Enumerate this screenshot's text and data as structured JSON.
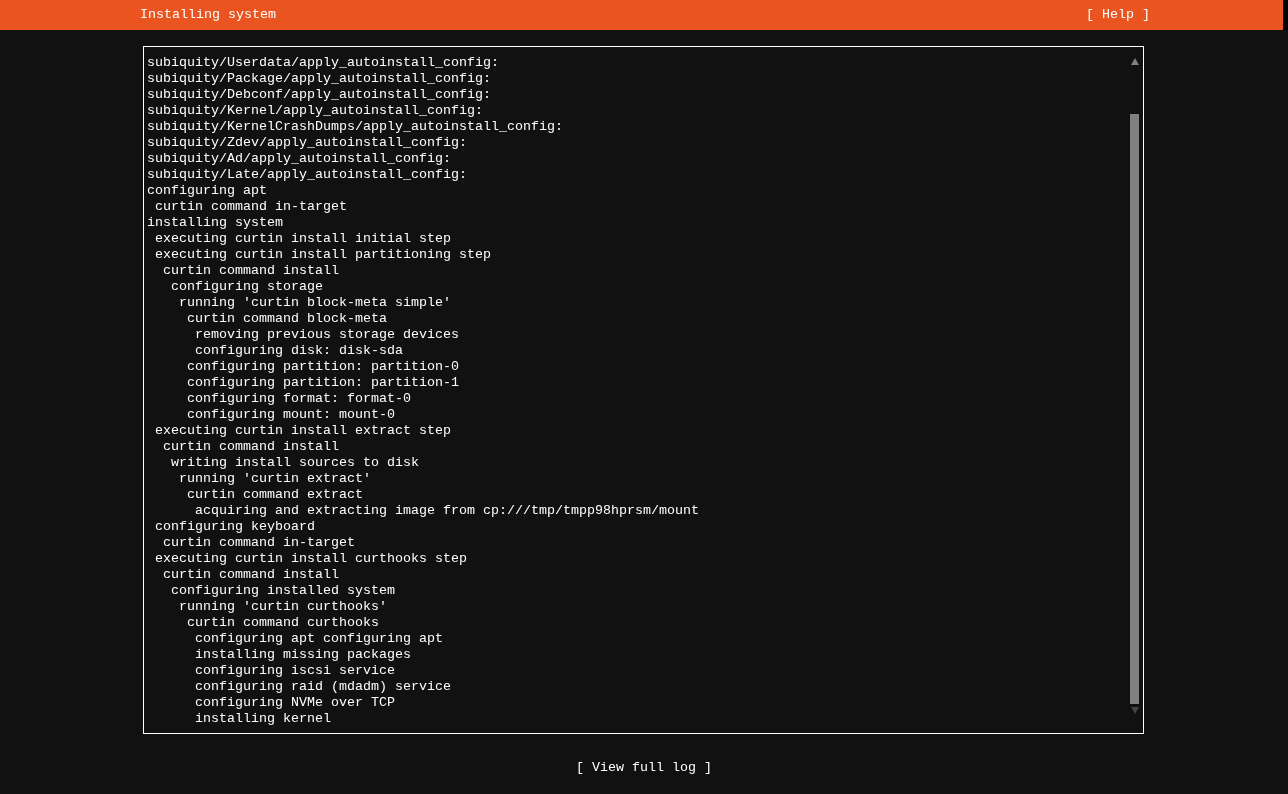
{
  "header": {
    "title": "Installing system",
    "help_button": "[ Help ]"
  },
  "log": [
    {
      "text": "subiquity/Userdata/apply_autoinstall_config:"
    },
    {
      "text": "subiquity/Package/apply_autoinstall_config:"
    },
    {
      "text": "subiquity/Debconf/apply_autoinstall_config:"
    },
    {
      "text": "subiquity/Kernel/apply_autoinstall_config:"
    },
    {
      "text": "subiquity/KernelCrashDumps/apply_autoinstall_config:"
    },
    {
      "text": "subiquity/Zdev/apply_autoinstall_config:"
    },
    {
      "text": "subiquity/Ad/apply_autoinstall_config:"
    },
    {
      "text": "subiquity/Late/apply_autoinstall_config:"
    },
    {
      "text": "configuring apt",
      "children": [
        {
          "text": "curtin command in-target"
        }
      ]
    },
    {
      "text": "installing system",
      "children": [
        {
          "text": "executing curtin install initial step"
        },
        {
          "text": "executing curtin install partitioning step",
          "children": [
            {
              "text": "curtin command install",
              "children": [
                {
                  "text": "configuring storage",
                  "children": [
                    {
                      "text": "running 'curtin block-meta simple'",
                      "children": [
                        {
                          "text": "curtin command block-meta",
                          "children": [
                            {
                              "text": "removing previous storage devices"
                            },
                            {
                              "text": "configuring disk: disk-sda"
                            }
                          ]
                        },
                        {
                          "text": "configuring partition: partition-0"
                        },
                        {
                          "text": "configuring partition: partition-1"
                        },
                        {
                          "text": "configuring format: format-0"
                        },
                        {
                          "text": "configuring mount: mount-0"
                        }
                      ]
                    }
                  ]
                }
              ]
            }
          ]
        },
        {
          "text": "executing curtin install extract step",
          "children": [
            {
              "text": "curtin command install",
              "children": [
                {
                  "text": "writing install sources to disk",
                  "children": [
                    {
                      "text": "running 'curtin extract'",
                      "children": [
                        {
                          "text": "curtin command extract",
                          "children": [
                            {
                              "text": "acquiring and extracting image from cp:///tmp/tmpp98hprsm/mount"
                            }
                          ]
                        }
                      ]
                    }
                  ]
                }
              ]
            }
          ]
        },
        {
          "text": "configuring keyboard",
          "children": [
            {
              "text": "curtin command in-target"
            }
          ]
        },
        {
          "text": "executing curtin install curthooks step",
          "children": [
            {
              "text": "curtin command install",
              "children": [
                {
                  "text": "configuring installed system",
                  "children": [
                    {
                      "text": "running 'curtin curthooks'",
                      "children": [
                        {
                          "text": "curtin command curthooks",
                          "children": [
                            {
                              "text": "configuring apt configuring apt"
                            },
                            {
                              "text": "installing missing packages"
                            },
                            {
                              "text": "configuring iscsi service"
                            },
                            {
                              "text": "configuring raid (mdadm) service"
                            },
                            {
                              "text": "configuring NVMe over TCP"
                            },
                            {
                              "text": "installing kernel"
                            }
                          ]
                        }
                      ]
                    }
                  ]
                }
              ]
            }
          ]
        }
      ]
    }
  ],
  "footer": {
    "view_log_button": "[ View full log ]"
  }
}
